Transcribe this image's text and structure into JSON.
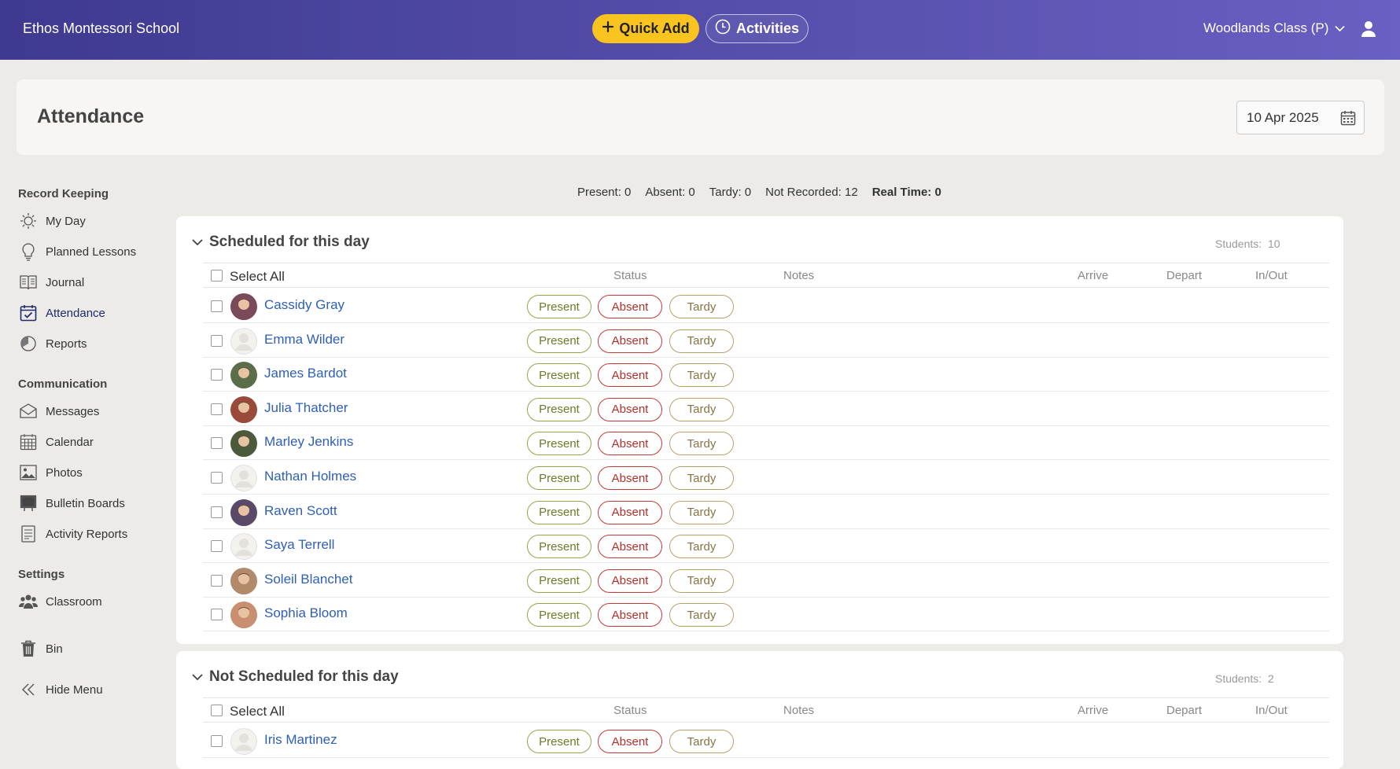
{
  "header": {
    "school_name": "Ethos Montessori School",
    "quick_add_label": "Quick Add",
    "activities_label": "Activities",
    "class_selector": "Woodlands Class (P)"
  },
  "page": {
    "title": "Attendance",
    "date": "10 Apr 2025"
  },
  "sidebar": {
    "sections": [
      {
        "title": "Record Keeping",
        "items": [
          {
            "label": "My Day",
            "icon": "sun-icon"
          },
          {
            "label": "Planned Lessons",
            "icon": "lightbulb-icon"
          },
          {
            "label": "Journal",
            "icon": "book-icon"
          },
          {
            "label": "Attendance",
            "icon": "calendar-check-icon",
            "active": true
          },
          {
            "label": "Reports",
            "icon": "pie-chart-icon"
          }
        ]
      },
      {
        "title": "Communication",
        "items": [
          {
            "label": "Messages",
            "icon": "envelope-icon"
          },
          {
            "label": "Calendar",
            "icon": "calendar-icon"
          },
          {
            "label": "Photos",
            "icon": "image-icon"
          },
          {
            "label": "Bulletin Boards",
            "icon": "board-icon"
          },
          {
            "label": "Activity Reports",
            "icon": "document-icon"
          }
        ]
      },
      {
        "title": "Settings",
        "items": [
          {
            "label": "Classroom",
            "icon": "users-icon"
          }
        ]
      }
    ],
    "bin_label": "Bin",
    "hide_menu_label": "Hide Menu"
  },
  "summary": {
    "present": "Present: 0",
    "absent": "Absent: 0",
    "tardy": "Tardy: 0",
    "not_recorded": "Not Recorded: 12",
    "real_time": "Real Time: 0"
  },
  "columns": {
    "select_all": "Select All",
    "status": "Status",
    "notes": "Notes",
    "arrive": "Arrive",
    "depart": "Depart",
    "inout": "In/Out"
  },
  "buttons": {
    "present": "Present",
    "absent": "Absent",
    "tardy": "Tardy"
  },
  "scheduled": {
    "title": "Scheduled for this day",
    "count_label": "Students:",
    "count": "10",
    "students": [
      {
        "name": "Cassidy Gray",
        "photo": true,
        "color": "#7a4a5a"
      },
      {
        "name": "Emma Wilder",
        "photo": false,
        "color": "#e3e1dc"
      },
      {
        "name": "James Bardot",
        "photo": true,
        "color": "#5a6e4a"
      },
      {
        "name": "Julia Thatcher",
        "photo": true,
        "color": "#9a4a3a"
      },
      {
        "name": "Marley Jenkins",
        "photo": true,
        "color": "#4a5a3a"
      },
      {
        "name": "Nathan Holmes",
        "photo": false,
        "color": "#e3e1dc"
      },
      {
        "name": "Raven Scott",
        "photo": true,
        "color": "#5a4a6a"
      },
      {
        "name": "Saya Terrell",
        "photo": false,
        "color": "#e3e1dc"
      },
      {
        "name": "Soleil Blanchet",
        "photo": true,
        "color": "#b08a6a"
      },
      {
        "name": "Sophia Bloom",
        "photo": true,
        "color": "#c89070"
      }
    ]
  },
  "not_scheduled": {
    "title": "Not Scheduled for this day",
    "count_label": "Students:",
    "count": "2",
    "students": [
      {
        "name": "Iris Martinez",
        "photo": false,
        "color": "#e3e1dc"
      }
    ]
  }
}
